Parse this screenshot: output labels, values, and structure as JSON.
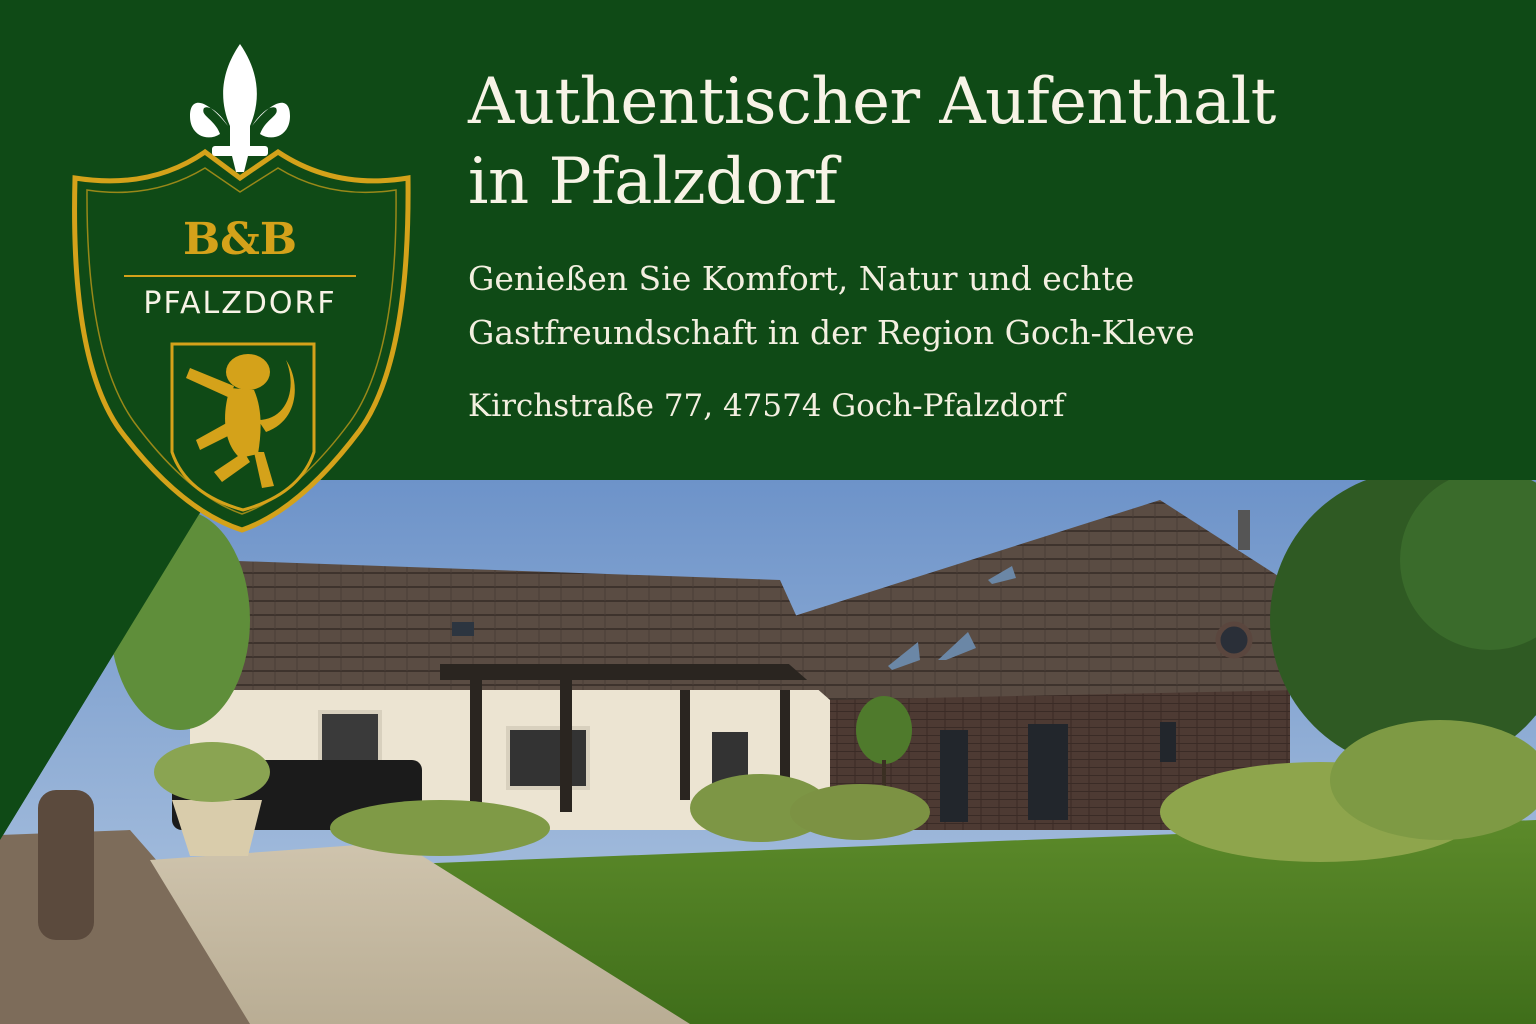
{
  "logo": {
    "title": "B&B",
    "subtitle": "PFALZDORF",
    "emblem_icon": "fleur-de-lis-icon",
    "heraldry_icon": "rampant-lion-icon"
  },
  "hero": {
    "headline_line1": "Authentischer Aufenthalt",
    "headline_line2": "in Pfalzdorf",
    "subline_line1": "Genießen Sie Komfort, Natur und echte",
    "subline_line2": "Gastfreundschaft in der Region Goch-Kleve",
    "address": "Kirchstraße 77, 47574 Goch-Pfalzdorf"
  },
  "colors": {
    "brand_green": "#0f4a16",
    "gold": "#d4a21a",
    "cream_text": "#f7f3e6"
  }
}
